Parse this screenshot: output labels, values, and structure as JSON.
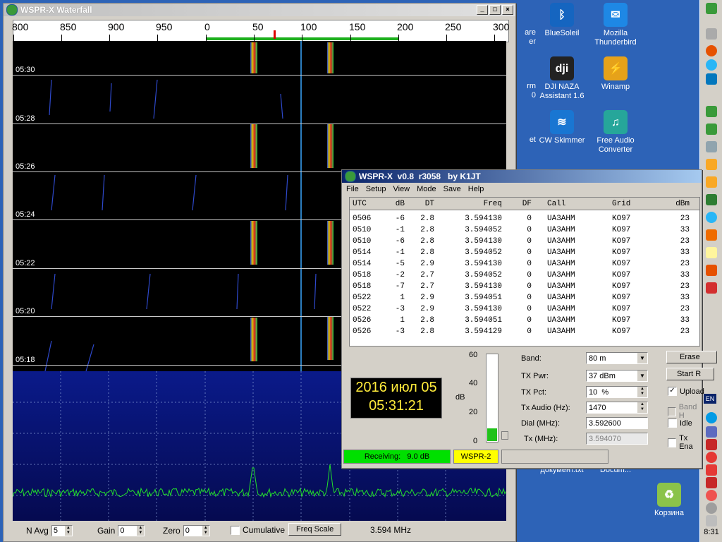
{
  "desktop": {
    "icons": [
      {
        "label": "BlueSoleil",
        "color": "#1565c0"
      },
      {
        "label": "Mozilla Thunderbird",
        "color": "#1e88e5"
      },
      {
        "label": "DJI NAZA Assistant 1.6",
        "color": "#222"
      },
      {
        "label": "Winamp",
        "color": "#e6a21a"
      },
      {
        "label": "CW Skimmer",
        "color": "#1976d2"
      },
      {
        "label": "Free Audio Converter",
        "color": "#26a69a"
      },
      {
        "label": "документ.txt",
        "color": "#ffffff"
      },
      {
        "label": "Docum...",
        "color": "#ffffff"
      },
      {
        "label": "Корзина",
        "color": "#8bc34a"
      }
    ],
    "partial_labels": [
      "are",
      "er",
      "rm",
      "0",
      "et"
    ]
  },
  "taskbar": {
    "clock": "8:31",
    "lang": "EN"
  },
  "waterfall": {
    "title": "WSPR-X Waterfall",
    "scale_ticks": [
      "800",
      "850",
      "900",
      "950",
      "0",
      "50",
      "100",
      "150",
      "200",
      "250",
      "300"
    ],
    "times": [
      "05:30",
      "05:28",
      "05:26",
      "05:24",
      "05:22",
      "05:20",
      "05:18"
    ],
    "bottom": {
      "navg_label": "N Avg",
      "navg_value": "5",
      "gain_label": "Gain",
      "gain_value": "0",
      "zero_label": "Zero",
      "zero_value": "0",
      "cumulative_label": "Cumulative",
      "freq_scale_button": "Freq Scale",
      "freq_readout": "3.594 MHz"
    }
  },
  "wsprx": {
    "title": "WSPR-X  v0.8  r3058   by K1JT",
    "menu": [
      "File",
      "Setup",
      "View",
      "Mode",
      "Save",
      "Help"
    ],
    "columns": [
      "UTC",
      "dB",
      "DT",
      "Freq",
      "DF",
      "Call",
      "Grid",
      "dBm"
    ],
    "rows": [
      [
        "0506",
        "-6",
        "2.8",
        "3.594130",
        "0",
        "UA3AHM",
        "KO97",
        "23"
      ],
      [
        "0510",
        "-1",
        "2.8",
        "3.594052",
        "0",
        "UA3AHM",
        "KO97",
        "33"
      ],
      [
        "0510",
        "-6",
        "2.8",
        "3.594130",
        "0",
        "UA3AHM",
        "KO97",
        "23"
      ],
      [
        "0514",
        "-1",
        "2.8",
        "3.594052",
        "0",
        "UA3AHM",
        "KO97",
        "33"
      ],
      [
        "0514",
        "-5",
        "2.9",
        "3.594130",
        "0",
        "UA3AHM",
        "KO97",
        "23"
      ],
      [
        "0518",
        "-2",
        "2.7",
        "3.594052",
        "0",
        "UA3AHM",
        "KO97",
        "33"
      ],
      [
        "0518",
        "-7",
        "2.7",
        "3.594130",
        "0",
        "UA3AHM",
        "KO97",
        "23"
      ],
      [
        "0522",
        "1",
        "2.9",
        "3.594051",
        "0",
        "UA3AHM",
        "KO97",
        "33"
      ],
      [
        "0522",
        "-3",
        "2.9",
        "3.594130",
        "0",
        "UA3AHM",
        "KO97",
        "23"
      ],
      [
        "0526",
        "1",
        "2.8",
        "3.594051",
        "0",
        "UA3AHM",
        "KO97",
        "33"
      ],
      [
        "0526",
        "-3",
        "2.8",
        "3.594129",
        "0",
        "UA3AHM",
        "KO97",
        "23"
      ]
    ],
    "clock_date": "2016 июл 05",
    "clock_time": "05:31:21",
    "meter": {
      "labels": [
        "60",
        "40",
        "20",
        "0"
      ],
      "unit": "dB",
      "level": 0.15
    },
    "fields": {
      "band_label": "Band:",
      "band_value": "80 m",
      "txpwr_label": "TX Pwr:",
      "txpwr_value": "37 dBm",
      "txpct_label": "TX Pct:",
      "txpct_value": "10  %",
      "txaudio_label": "Tx Audio (Hz):",
      "txaudio_value": "1470",
      "dial_label": "Dial (MHz):",
      "dial_value": "3.592600",
      "txmhz_label": "Tx (MHz):",
      "txmhz_value": "3.594070"
    },
    "buttons": {
      "erase": "Erase",
      "start": "Start R"
    },
    "checks": {
      "upload": "Upload",
      "band": "Band H",
      "idle": "Idle",
      "tx_enable": "Tx Ena"
    },
    "status": {
      "receiving": "Receiving:   9.0 dB",
      "mode": "WSPR-2"
    }
  }
}
